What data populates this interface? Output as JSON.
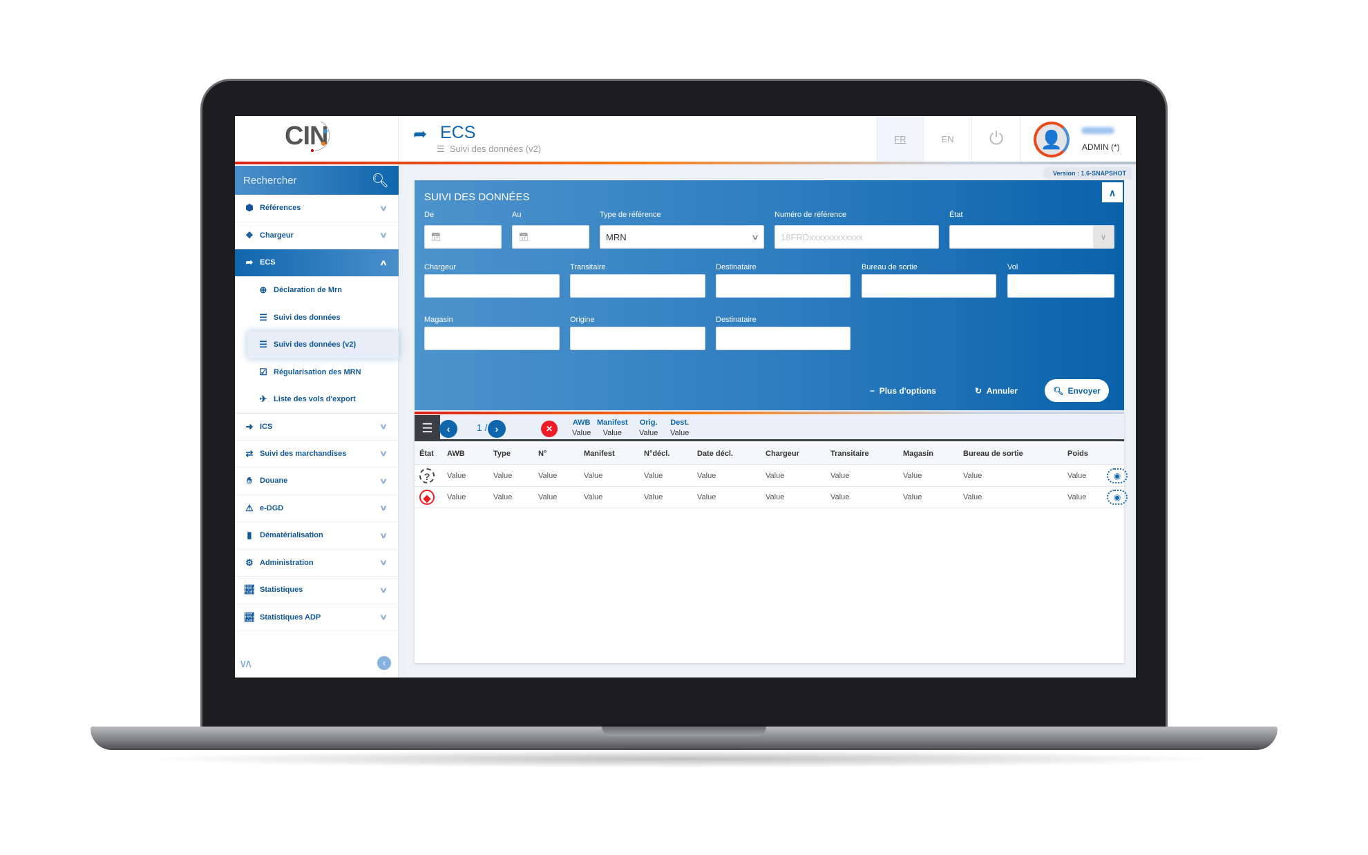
{
  "header": {
    "logo": "CIN",
    "title": "ECS",
    "breadcrumb": "Suivi des données (v2)",
    "lang_fr": "FR",
    "lang_en": "EN",
    "role": "ADMIN (*)",
    "version": "Version : 1.6-SNAPSHOT"
  },
  "sidebar": {
    "search_placeholder": "Rechercher",
    "items": [
      {
        "label": "Références"
      },
      {
        "label": "Chargeur"
      },
      {
        "label": "ECS"
      },
      {
        "label": "Déclaration de Mrn"
      },
      {
        "label": "Suivi des données"
      },
      {
        "label": "Suivi des données (v2)"
      },
      {
        "label": "Régularisation des MRN"
      },
      {
        "label": "Liste des vols d'export"
      },
      {
        "label": "ICS"
      },
      {
        "label": "Suivi des marchandises"
      },
      {
        "label": "Douane"
      },
      {
        "label": "e-DGD"
      },
      {
        "label": "Dématérialisation"
      },
      {
        "label": "Administration"
      },
      {
        "label": "Statistiques"
      },
      {
        "label": "Statistiques ADP"
      }
    ]
  },
  "filters": {
    "title": "SUIVI DES DONNÉES",
    "de": "De",
    "au": "Au",
    "type_ref": "Type de référence",
    "type_ref_value": "MRN",
    "num_ref": "Numéro de référence",
    "num_ref_placeholder": "18FRDxxxxxxxxxxxx",
    "etat": "État",
    "chargeur": "Chargeur",
    "transitaire": "Transitaire",
    "destinataire": "Destinataire",
    "bureau": "Bureau de sortie",
    "vol": "Vol",
    "magasin": "Magasin",
    "origine": "Origine",
    "destinataire2": "Destinataire",
    "more": "Plus d'options",
    "cancel": "Annuler",
    "send": "Envoyer"
  },
  "results": {
    "page": "1 / 2",
    "chips": [
      {
        "k": "AWB",
        "v": "Value"
      },
      {
        "k": "Manifest",
        "v": "Value"
      },
      {
        "k": "Orig.",
        "v": "Value"
      },
      {
        "k": "Dest.",
        "v": "Value"
      }
    ],
    "columns": [
      "État",
      "AWB",
      "Type",
      "N°",
      "Manifest",
      "N°décl.",
      "Date décl.",
      "Chargeur",
      "Transitaire",
      "Magasin",
      "Bureau de sortie",
      "Poids"
    ],
    "rows": [
      {
        "status": "unknown",
        "cells": [
          "Value",
          "Value",
          "Value",
          "Value",
          "Value",
          "Value",
          "Value",
          "Value",
          "Value",
          "Value",
          "Value"
        ]
      },
      {
        "status": "error",
        "cells": [
          "Value",
          "Value",
          "Value",
          "Value",
          "Value",
          "Value",
          "Value",
          "Value",
          "Value",
          "Value",
          "Value"
        ]
      }
    ]
  },
  "colors": {
    "primary": "#1066ac",
    "accent": "#f57b16",
    "danger": "#ee1c25"
  }
}
